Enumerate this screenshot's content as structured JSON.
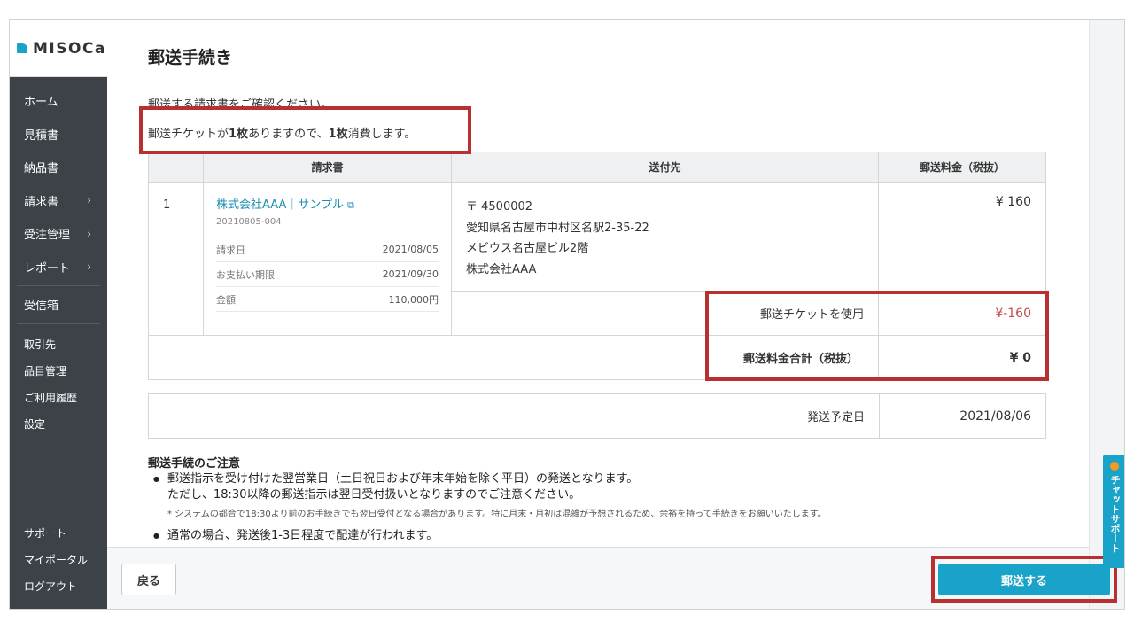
{
  "brand": {
    "name": "MISOCa"
  },
  "sidebar": {
    "items": [
      {
        "label": "ホーム",
        "chevron": ""
      },
      {
        "label": "見積書",
        "chevron": ""
      },
      {
        "label": "納品書",
        "chevron": ""
      },
      {
        "label": "請求書",
        "chevron": "›"
      },
      {
        "label": "受注管理",
        "chevron": "›"
      },
      {
        "label": "レポート",
        "chevron": "›"
      },
      {
        "label": "受信箱",
        "chevron": ""
      }
    ],
    "items2": [
      {
        "label": "取引先"
      },
      {
        "label": "品目管理"
      },
      {
        "label": "ご利用履歴"
      },
      {
        "label": "設定"
      }
    ],
    "items3": [
      {
        "label": "サポート"
      },
      {
        "label": "マイポータル"
      },
      {
        "label": "ログアウト"
      }
    ]
  },
  "main": {
    "title": "郵送手続き",
    "confirm_text": "郵送する請求書をご確認ください。",
    "ticket": {
      "pre": "郵送チケットが",
      "count1": "1枚",
      "mid": "ありますので、",
      "count2": "1枚",
      "post": "消費します。"
    },
    "table": {
      "headers": {
        "invoice": "請求書",
        "destination": "送付先",
        "fee": "郵送料金（税抜）"
      },
      "row": {
        "num": "1",
        "invoice_name": "株式会社AAA｜サンプル",
        "invoice_no": "20210805-004",
        "fields": [
          {
            "key": "請求日",
            "value": "2021/08/05"
          },
          {
            "key": "お支払い期限",
            "value": "2021/09/30"
          },
          {
            "key": "金額",
            "value": "110,000円"
          }
        ],
        "dest": {
          "postal": "〒 4500002",
          "address": "愛知県名古屋市中村区名駅2-35-22",
          "building": "メビウス名古屋ビル2階",
          "company": "株式会社AAA"
        },
        "fee": "¥ 160"
      },
      "ticket_use_label": "郵送チケットを使用",
      "ticket_use_value": "¥-160",
      "total_label": "郵送料金合計（税抜）",
      "total_value": "¥ 0"
    },
    "ship": {
      "label": "発送予定日",
      "value": "2021/08/06"
    },
    "notes": {
      "title": "郵送手続のご注意",
      "item1_line1": "郵送指示を受け付けた翌営業日（土日祝日および年末年始を除く平日）の発送となります。",
      "item1_line2": "ただし、18:30以降の郵送指示は翌日受付扱いとなりますのでご注意ください。",
      "fine": "* システムの都合で18:30より前のお手続きでも翌日受付となる場合があります。特に月末・月初は混雑が予想されるため、余裕を持って手続きをお願いいたします。",
      "item2": "通常の場合、発送後1-3日程度で配達が行われます。"
    }
  },
  "footer": {
    "back_label": "戻る",
    "send_label": "郵送する"
  },
  "chat": {
    "label": "チャットサポート"
  },
  "colors": {
    "accent": "#1aa3c8",
    "sidebar": "#3c4248",
    "highlight": "#b83030",
    "negative": "#c54a4a"
  }
}
